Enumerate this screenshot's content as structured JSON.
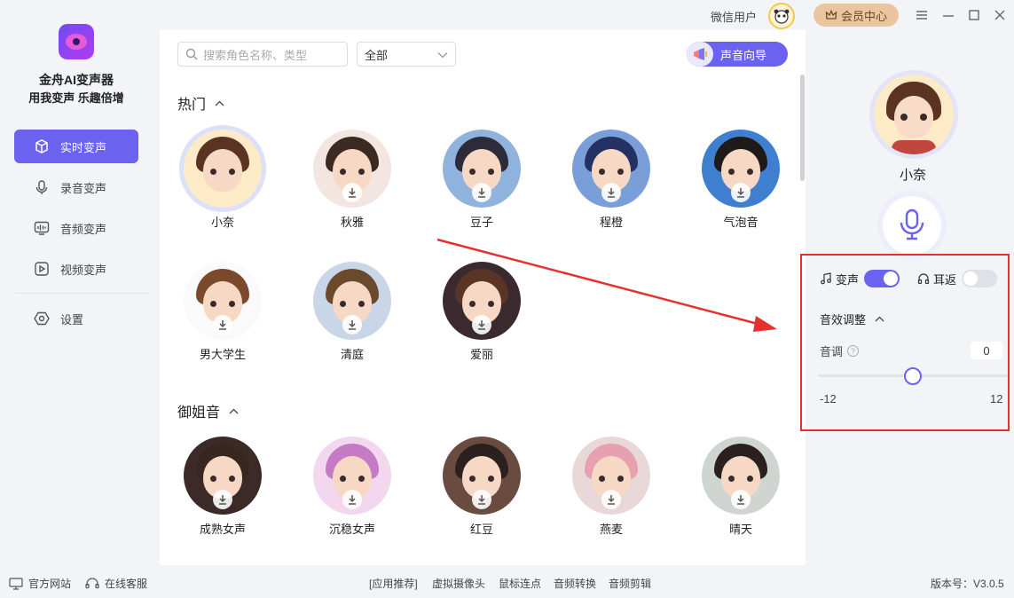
{
  "app": {
    "name": "金舟AI变声器",
    "slogan": "用我变声 乐趣倍增"
  },
  "sidebar": {
    "items": [
      {
        "label": "实时变声",
        "icon": "cube-icon",
        "active": true
      },
      {
        "label": "录音变声",
        "icon": "microphone-icon",
        "active": false
      },
      {
        "label": "音频变声",
        "icon": "audio-wave-icon",
        "active": false
      },
      {
        "label": "视频变声",
        "icon": "play-icon",
        "active": false
      },
      {
        "label": "设置",
        "icon": "hexagon-settings-icon",
        "active": false
      }
    ]
  },
  "header": {
    "user_name": "微信用户",
    "member_label": "会员中心",
    "window_controls": [
      "menu-icon",
      "minimize-icon",
      "maximize-icon",
      "close-icon"
    ]
  },
  "toolbar": {
    "search_placeholder": "搜索角色名称、类型",
    "filter_value": "全部",
    "guide_label": "声音向导"
  },
  "sections": [
    {
      "title": "热门",
      "voices": [
        {
          "name": "小奈",
          "selected": true,
          "downloadable": false
        },
        {
          "name": "秋雅",
          "downloadable": true
        },
        {
          "name": "豆子",
          "downloadable": true
        },
        {
          "name": "程橙",
          "downloadable": true
        },
        {
          "name": "气泡音",
          "downloadable": true
        },
        {
          "name": "男大学生",
          "downloadable": true
        },
        {
          "name": "清庭",
          "downloadable": true
        },
        {
          "name": "爱丽",
          "downloadable": true
        }
      ]
    },
    {
      "title": "御姐音",
      "voices": [
        {
          "name": "成熟女声",
          "downloadable": true
        },
        {
          "name": "沉稳女声",
          "downloadable": true
        },
        {
          "name": "红豆",
          "downloadable": true
        },
        {
          "name": "燕麦",
          "downloadable": true
        },
        {
          "name": "晴天",
          "downloadable": true
        }
      ]
    }
  ],
  "current": {
    "voice_name": "小奈",
    "voice_change_label": "变声",
    "voice_change_on": true,
    "monitor_label": "耳返",
    "monitor_on": false,
    "effects_title": "音效调整",
    "pitch_label": "音调",
    "pitch_value": "0",
    "pitch_min": "-12",
    "pitch_max": "12"
  },
  "footer": {
    "website": "官方网站",
    "support": "在线客服",
    "recommend": "[应用推荐]",
    "links": [
      "虚拟摄像头",
      "鼠标连点",
      "音频转换",
      "音频剪辑"
    ],
    "version": "版本号：V3.0.5"
  },
  "colors": {
    "accent": "#6b63f0",
    "highlight_box": "#e53030",
    "member": "#e9c6a0"
  }
}
